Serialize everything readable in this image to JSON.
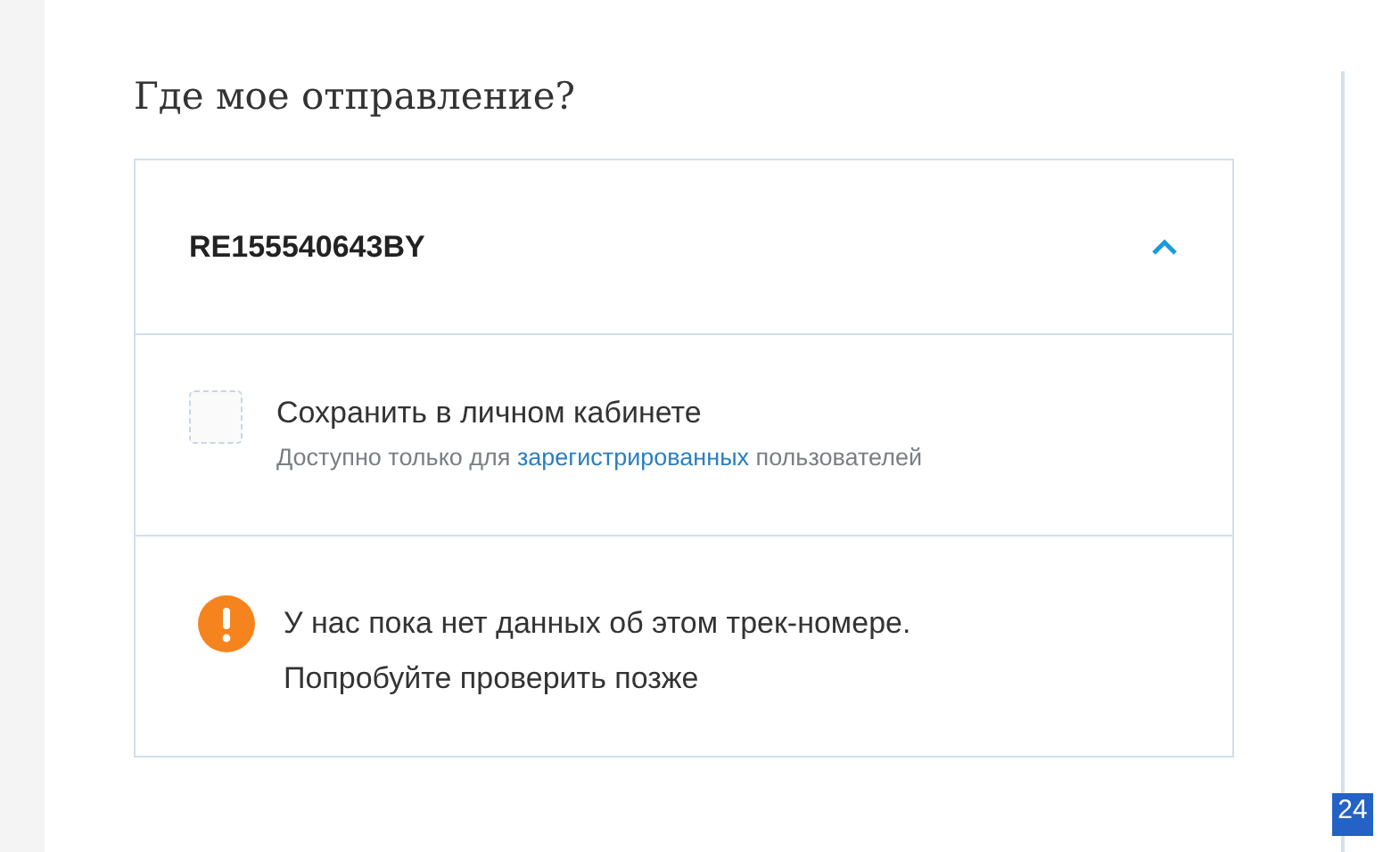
{
  "title": "Где мое отправление?",
  "tracking": {
    "number": "RE155540643BY",
    "expanded": true
  },
  "save_option": {
    "label": "Сохранить в личном кабинете",
    "checked": false,
    "note": [
      "Доступно только для ",
      "зарегистрированных",
      " пользователей"
    ]
  },
  "message": {
    "lines": [
      "У нас пока нет данных об этом трек-номере.",
      "Попробуйте проверить позже"
    ]
  },
  "corner_badge": "24"
}
